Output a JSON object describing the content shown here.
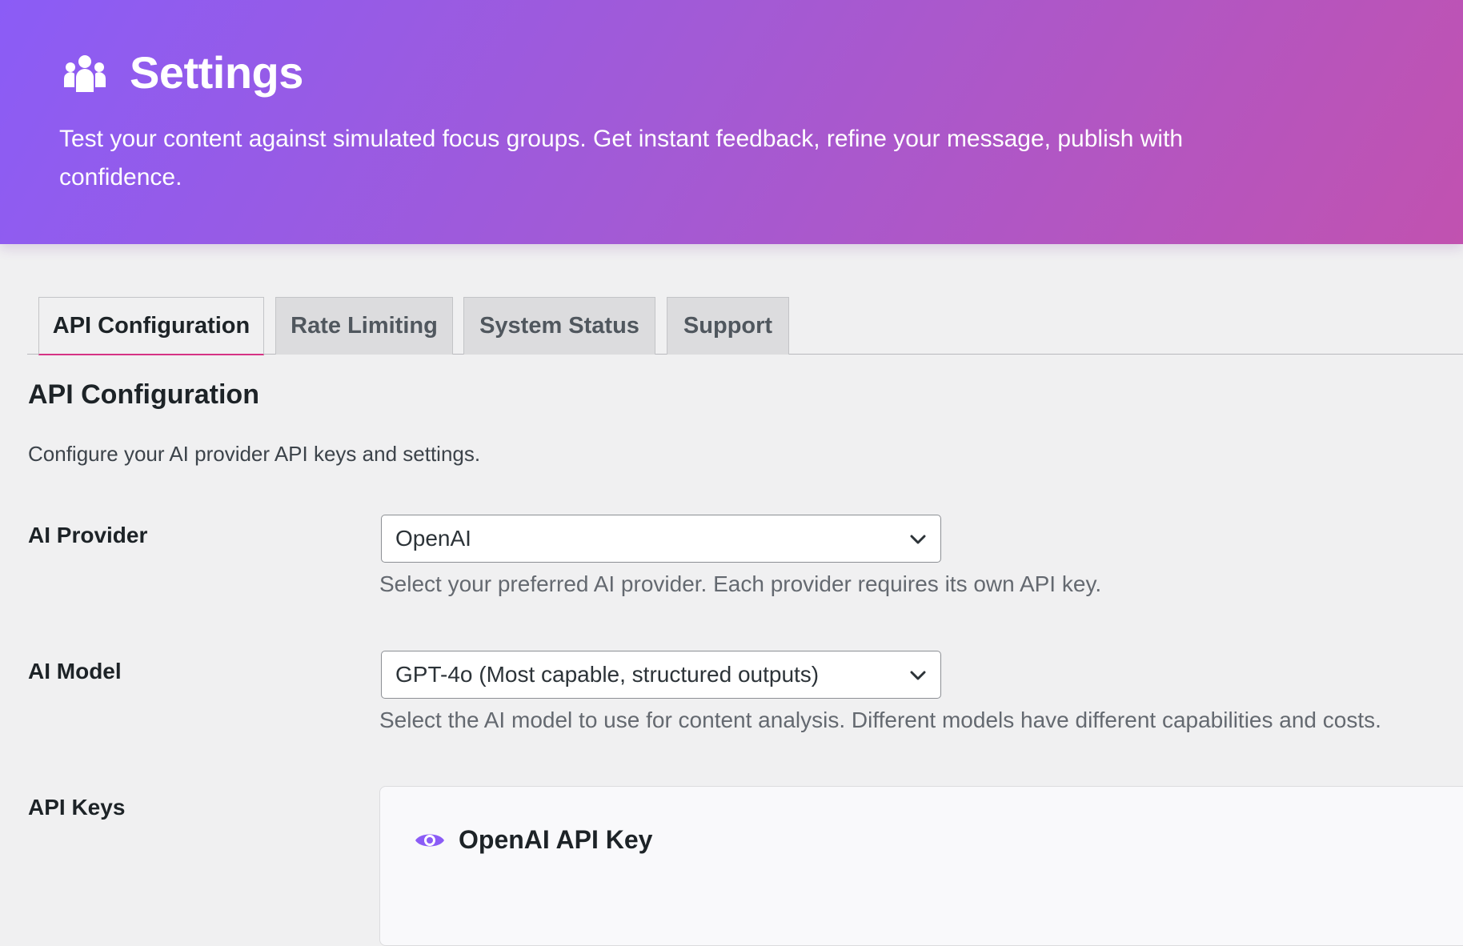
{
  "header": {
    "title": "Settings",
    "icon": "users-icon",
    "description": "Test your content against simulated focus groups. Get instant feedback, refine your message, publish with confidence."
  },
  "tabs": [
    {
      "label": "API Configuration",
      "active": true
    },
    {
      "label": "Rate Limiting",
      "active": false
    },
    {
      "label": "System Status",
      "active": false
    },
    {
      "label": "Support",
      "active": false
    }
  ],
  "section": {
    "title": "API Configuration",
    "description": "Configure your AI provider API keys and settings."
  },
  "fields": {
    "provider": {
      "label": "AI Provider",
      "value": "OpenAI",
      "help": "Select your preferred AI provider. Each provider requires its own API key."
    },
    "model": {
      "label": "AI Model",
      "value": "GPT-4o (Most capable, structured outputs)",
      "help": "Select the AI model to use for content analysis. Different models have different capabilities and costs."
    },
    "keys": {
      "label": "API Keys",
      "openai_title": "OpenAI API Key",
      "icon": "eye-icon"
    }
  },
  "colors": {
    "gradient_start": "#8b5cf6",
    "gradient_end": "#c152b0",
    "active_tab_underline": "#d63384",
    "eye_icon": "#8b5cf6"
  }
}
